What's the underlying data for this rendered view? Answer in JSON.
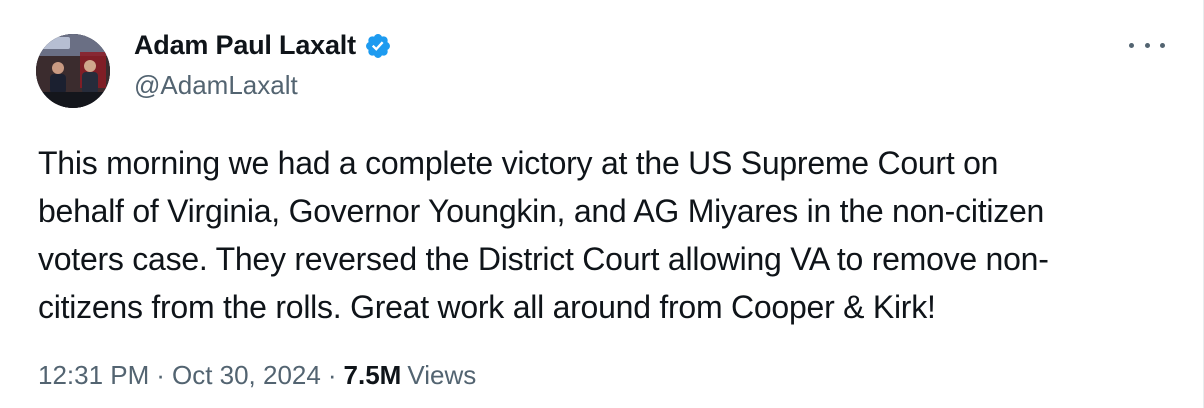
{
  "author": {
    "display_name": "Adam Paul Laxalt",
    "handle": "@AdamLaxalt",
    "verified": true,
    "avatar_icon": "profile-photo-icon",
    "verified_icon": "verified-badge-icon",
    "verified_color": "#1d9bf0"
  },
  "menu": {
    "icon": "more-options-icon"
  },
  "tweet": {
    "lines": [
      "This morning we had a complete victory at the US Supreme Court on",
      "behalf of Virginia, Governor Youngkin, and AG Miyares in the non-citizen",
      "voters case. They reversed the District Court allowing VA to remove non-",
      "citizens from the rolls. Great work all around from Cooper & Kirk!"
    ]
  },
  "meta": {
    "time": "12:31 PM",
    "separator": "·",
    "date": "Oct 30, 2024",
    "views_count": "7.5M",
    "views_label": "Views"
  }
}
